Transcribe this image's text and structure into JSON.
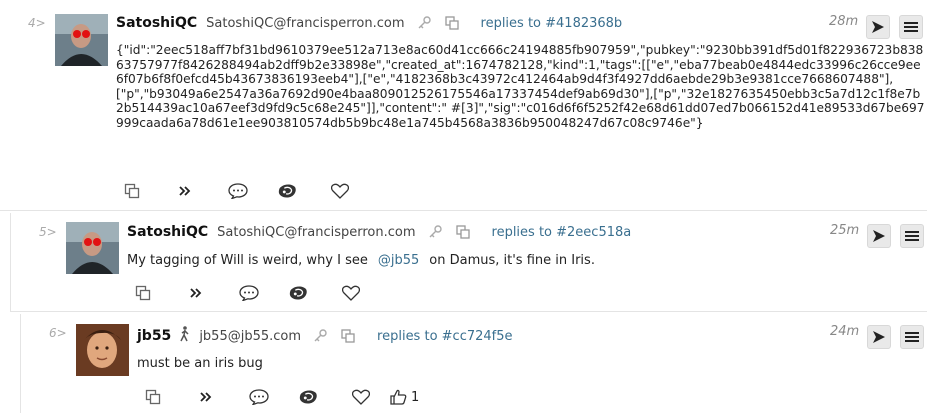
{
  "posts": [
    {
      "index": "4>",
      "name": "SatoshiQC",
      "nip05": "SatoshiQC@francisperron.com",
      "reply_to": "replies to #4182368b",
      "age": "28m",
      "content_json": "{\"id\":\"2eec518aff7bf31bd9610379ee512a713e8ac60d41cc666c24194885fb907959\",\"pubkey\":\"9230bb391df5d01f822936723b83863757977f8426288494ab2dff9b2e33898e\",\"created_at\":1674782128,\"kind\":1,\"tags\":[[\"e\",\"eba77beab0e4844edc33996c26cce9ee6f07b6f8f0efcd45b43673836193eeb4\"],[\"e\",\"4182368b3c43972c412464ab9d4f3f4927dd6aebde29b3e9381cce7668607488\"],[\"p\",\"b93049a6e2547a36a7692d90e4baa809012526175546a17337454def9ab69d30\"],[\"p\",\"32e1827635450ebb3c5a7d12c1f8e7b2b514439ac10a67eef3d9fd9c5c68e245\"]],\"content\":\" #[3]\",\"sig\":\"c016d6f6f5252f42e68d61dd07ed7b066152d41e89533d67be697999caada6a78d61e1ee903810574db5b9bc48e1a745b4568a3836b950048247d67c08c9746e\"}"
    },
    {
      "index": "5>",
      "name": "SatoshiQC",
      "nip05": "SatoshiQC@francisperron.com",
      "reply_to": "replies to #2eec518a",
      "age": "25m",
      "text_before": "My tagging of Will is weird, why I see",
      "mention": "@jb55",
      "text_after": "on Damus, it's fine in Iris."
    },
    {
      "index": "6>",
      "name": "jb55",
      "nip05": "jb55@jb55.com",
      "reply_to": "replies to #cc724f5e",
      "age": "24m",
      "text": "must be an iris bug",
      "reaction_count": "1"
    }
  ]
}
